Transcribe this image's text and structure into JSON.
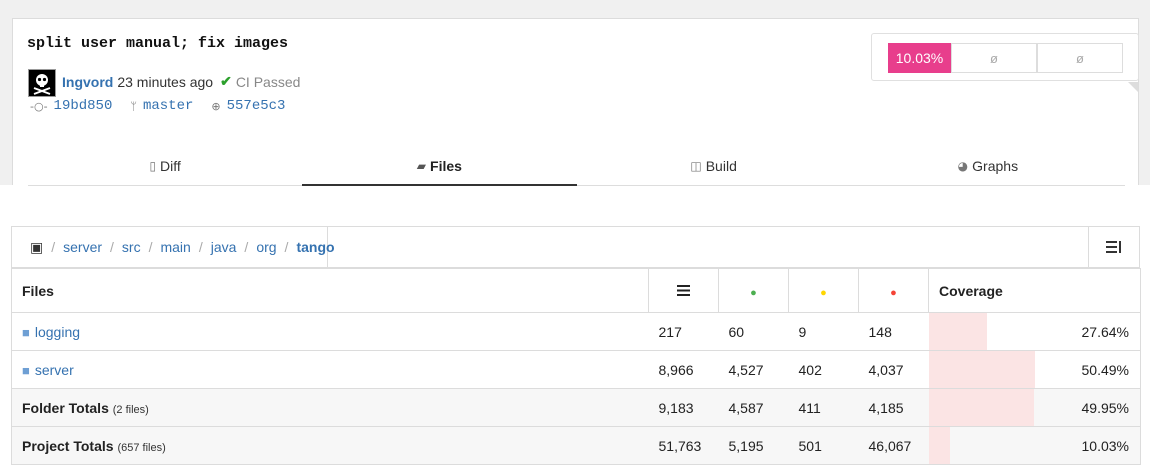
{
  "commit": {
    "title": "split user manual; fix images",
    "author": "Ingvord",
    "time": "23 minutes ago",
    "ci_status": "CI Passed",
    "sha": "19bd850",
    "branch": "master",
    "parent": "557e5c3"
  },
  "coverage_badge": {
    "main": "10.03%",
    "b": "ø",
    "c": "ø",
    "colors": {
      "main": "#e83e8c"
    }
  },
  "tabs": [
    {
      "label": "Diff",
      "icon": "diff-icon"
    },
    {
      "label": "Files",
      "icon": "folder-icon",
      "active": true
    },
    {
      "label": "Build",
      "icon": "cube-icon"
    },
    {
      "label": "Graphs",
      "icon": "pie-chart-icon"
    }
  ],
  "breadcrumb": [
    "server",
    "src",
    "main",
    "java",
    "org",
    "tango"
  ],
  "table": {
    "headers": {
      "files": "Files",
      "coverage": "Coverage"
    },
    "dot_colors": {
      "hit": "#4caf50",
      "partial": "#ffd600",
      "miss": "#f44336"
    },
    "rows": [
      {
        "name": "logging",
        "lines": "217",
        "hit": "60",
        "partial": "9",
        "miss": "148",
        "coverage": "27.64%",
        "coverage_pct": 27.64
      },
      {
        "name": "server",
        "lines": "8,966",
        "hit": "4,527",
        "partial": "402",
        "miss": "4,037",
        "coverage": "50.49%",
        "coverage_pct": 50.49
      }
    ],
    "folder_totals": {
      "label": "Folder Totals",
      "sub": "(2 files)",
      "lines": "9,183",
      "hit": "4,587",
      "partial": "411",
      "miss": "4,185",
      "coverage": "49.95%",
      "coverage_pct": 49.95
    },
    "project_totals": {
      "label": "Project Totals",
      "sub": "(657 files)",
      "lines": "51,763",
      "hit": "5,195",
      "partial": "501",
      "miss": "46,067",
      "coverage": "10.03%",
      "coverage_pct": 10.03
    }
  }
}
